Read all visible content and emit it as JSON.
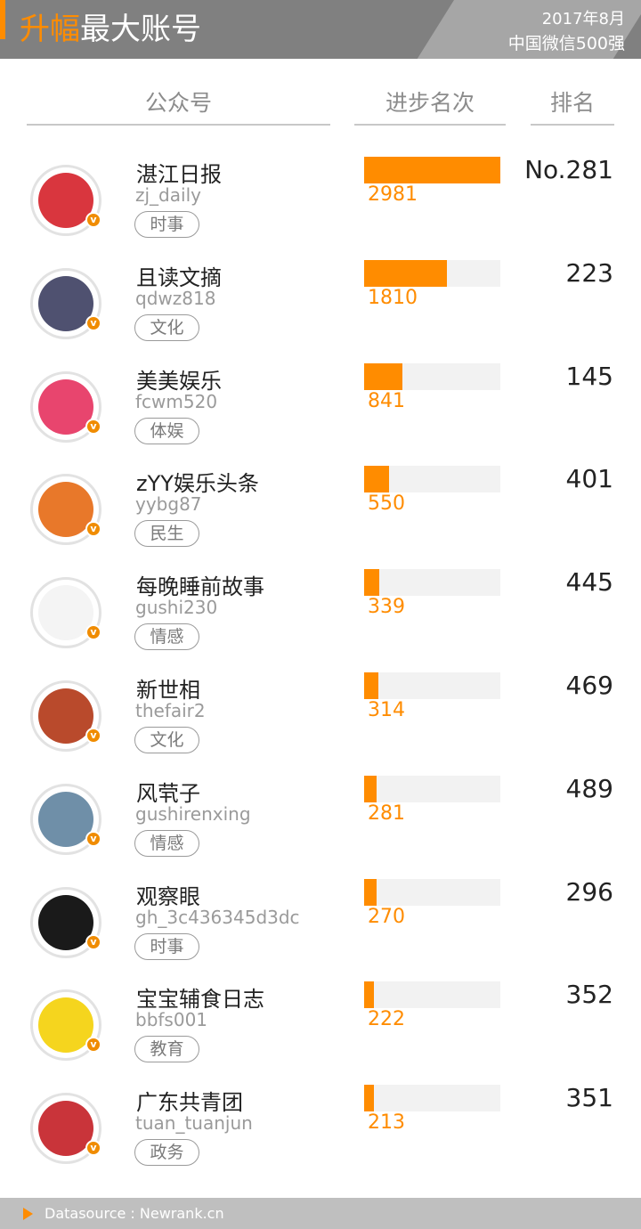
{
  "header": {
    "title_highlight": "升幅",
    "title_rest": "最大账号",
    "date": "2017年8月",
    "subtitle": "中国微信500强"
  },
  "columns": {
    "account": "公众号",
    "progress": "进步名次",
    "rank": "排名"
  },
  "colors": {
    "accent": "#ff8c00",
    "header_bg": "#808080",
    "footer_bg": "#bfbfbf",
    "bar_track": "#f2f2f2"
  },
  "chart_data": {
    "type": "bar",
    "xlabel": "进步名次",
    "max": 2981,
    "categories": [
      "湛江日报",
      "且读文摘",
      "美美娱乐",
      "zYY娱乐头条",
      "每晚睡前故事",
      "新世相",
      "风茕子",
      "观察眼",
      "宝宝辅食日志",
      "广东共青团"
    ],
    "values": [
      2981,
      1810,
      841,
      550,
      339,
      314,
      281,
      270,
      222,
      213
    ]
  },
  "rows": [
    {
      "name": "湛江日报",
      "account": "zj_daily",
      "tag": "时事",
      "progress": "2981",
      "rank": "No.281",
      "avatar_color": "#d9363e"
    },
    {
      "name": "且读文摘",
      "account": "qdwz818",
      "tag": "文化",
      "progress": "1810",
      "rank": "223",
      "avatar_color": "#4f5170"
    },
    {
      "name": "美美娱乐",
      "account": "fcwm520",
      "tag": "体娱",
      "progress": "841",
      "rank": "145",
      "avatar_color": "#e8456e"
    },
    {
      "name": "zYY娱乐头条",
      "account": "yybg87",
      "tag": "民生",
      "progress": "550",
      "rank": "401",
      "avatar_color": "#e8782a"
    },
    {
      "name": "每晚睡前故事",
      "account": "gushi230",
      "tag": "情感",
      "progress": "339",
      "rank": "445",
      "avatar_color": "#f4f4f4"
    },
    {
      "name": "新世相",
      "account": "thefair2",
      "tag": "文化",
      "progress": "314",
      "rank": "469",
      "avatar_color": "#b94a2c"
    },
    {
      "name": "风茕子",
      "account": "gushirenxing",
      "tag": "情感",
      "progress": "281",
      "rank": "489",
      "avatar_color": "#6f8fa8"
    },
    {
      "name": "观察眼",
      "account": "gh_3c436345d3dc",
      "tag": "时事",
      "progress": "270",
      "rank": "296",
      "avatar_color": "#1a1a1a"
    },
    {
      "name": "宝宝辅食日志",
      "account": "bbfs001",
      "tag": "教育",
      "progress": "222",
      "rank": "352",
      "avatar_color": "#f5d51e"
    },
    {
      "name": "广东共青团",
      "account": "tuan_tuanjun",
      "tag": "政务",
      "progress": "213",
      "rank": "351",
      "avatar_color": "#c9343a"
    }
  ],
  "footer": {
    "source": "Datasource : Newrank.cn"
  }
}
